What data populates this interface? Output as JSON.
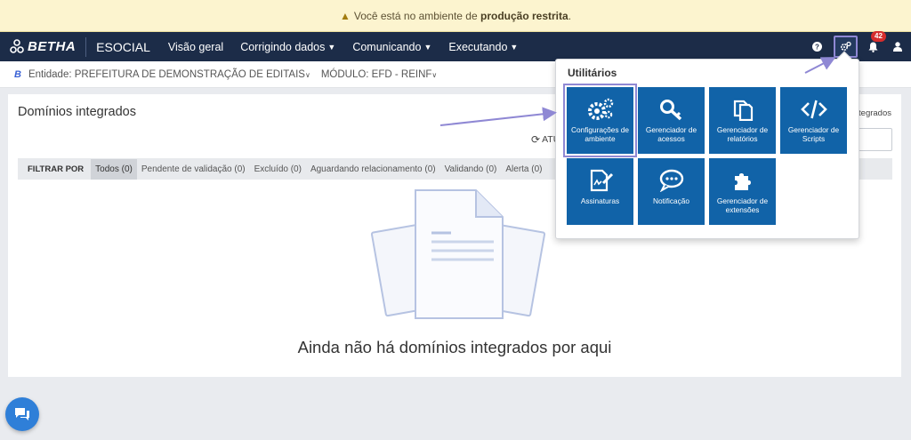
{
  "banner": {
    "prefix": "Você está no ambiente de ",
    "highlight": "produção restrita",
    "suffix": ".",
    "icon": "warning-icon"
  },
  "nav": {
    "brand": "BETHA",
    "product": "ESOCIAL",
    "menu": [
      {
        "label": "Visão geral",
        "dropdown": false
      },
      {
        "label": "Corrigindo dados",
        "dropdown": true
      },
      {
        "label": "Comunicando",
        "dropdown": true
      },
      {
        "label": "Executando",
        "dropdown": true
      }
    ],
    "notification_count": "42",
    "icons": [
      "help-icon",
      "gears-icon",
      "bell-icon",
      "user-icon"
    ]
  },
  "context": {
    "logo": "B",
    "entity": "Entidade: PREFEITURA DE DEMONSTRAÇÃO DE EDITAIS",
    "module": "MÓDULO: EFD - REINF"
  },
  "page": {
    "title": "Domínios integrados",
    "refresh_label": "ATU",
    "right_label": "tegrados",
    "filter_label": "FILTRAR POR",
    "filters": [
      "Todos (0)",
      "Pendente de validação (0)",
      "Excluído (0)",
      "Aguardando relacionamento (0)",
      "Validando (0)",
      "Alerta (0)"
    ],
    "empty_message": "Ainda não há domínios integrados por aqui"
  },
  "utilities": {
    "title": "Utilitários",
    "tiles": [
      {
        "label": "Configurações de ambiente",
        "icon": "gears-icon"
      },
      {
        "label": "Gerenciador de acessos",
        "icon": "key-icon"
      },
      {
        "label": "Gerenciador de relatórios",
        "icon": "copy-icon"
      },
      {
        "label": "Gerenciador de Scripts",
        "icon": "code-icon"
      },
      {
        "label": "Assinaturas",
        "icon": "signature-icon"
      },
      {
        "label": "Notificação",
        "icon": "comment-icon"
      },
      {
        "label": "Gerenciador de extensões",
        "icon": "puzzle-icon"
      }
    ]
  },
  "colors": {
    "nav_bg": "#1c2c48",
    "tile_bg": "#1163a8",
    "highlight_outline": "#8f88d4",
    "banner_bg": "#fcf4cf",
    "badge": "#d62d2d"
  }
}
